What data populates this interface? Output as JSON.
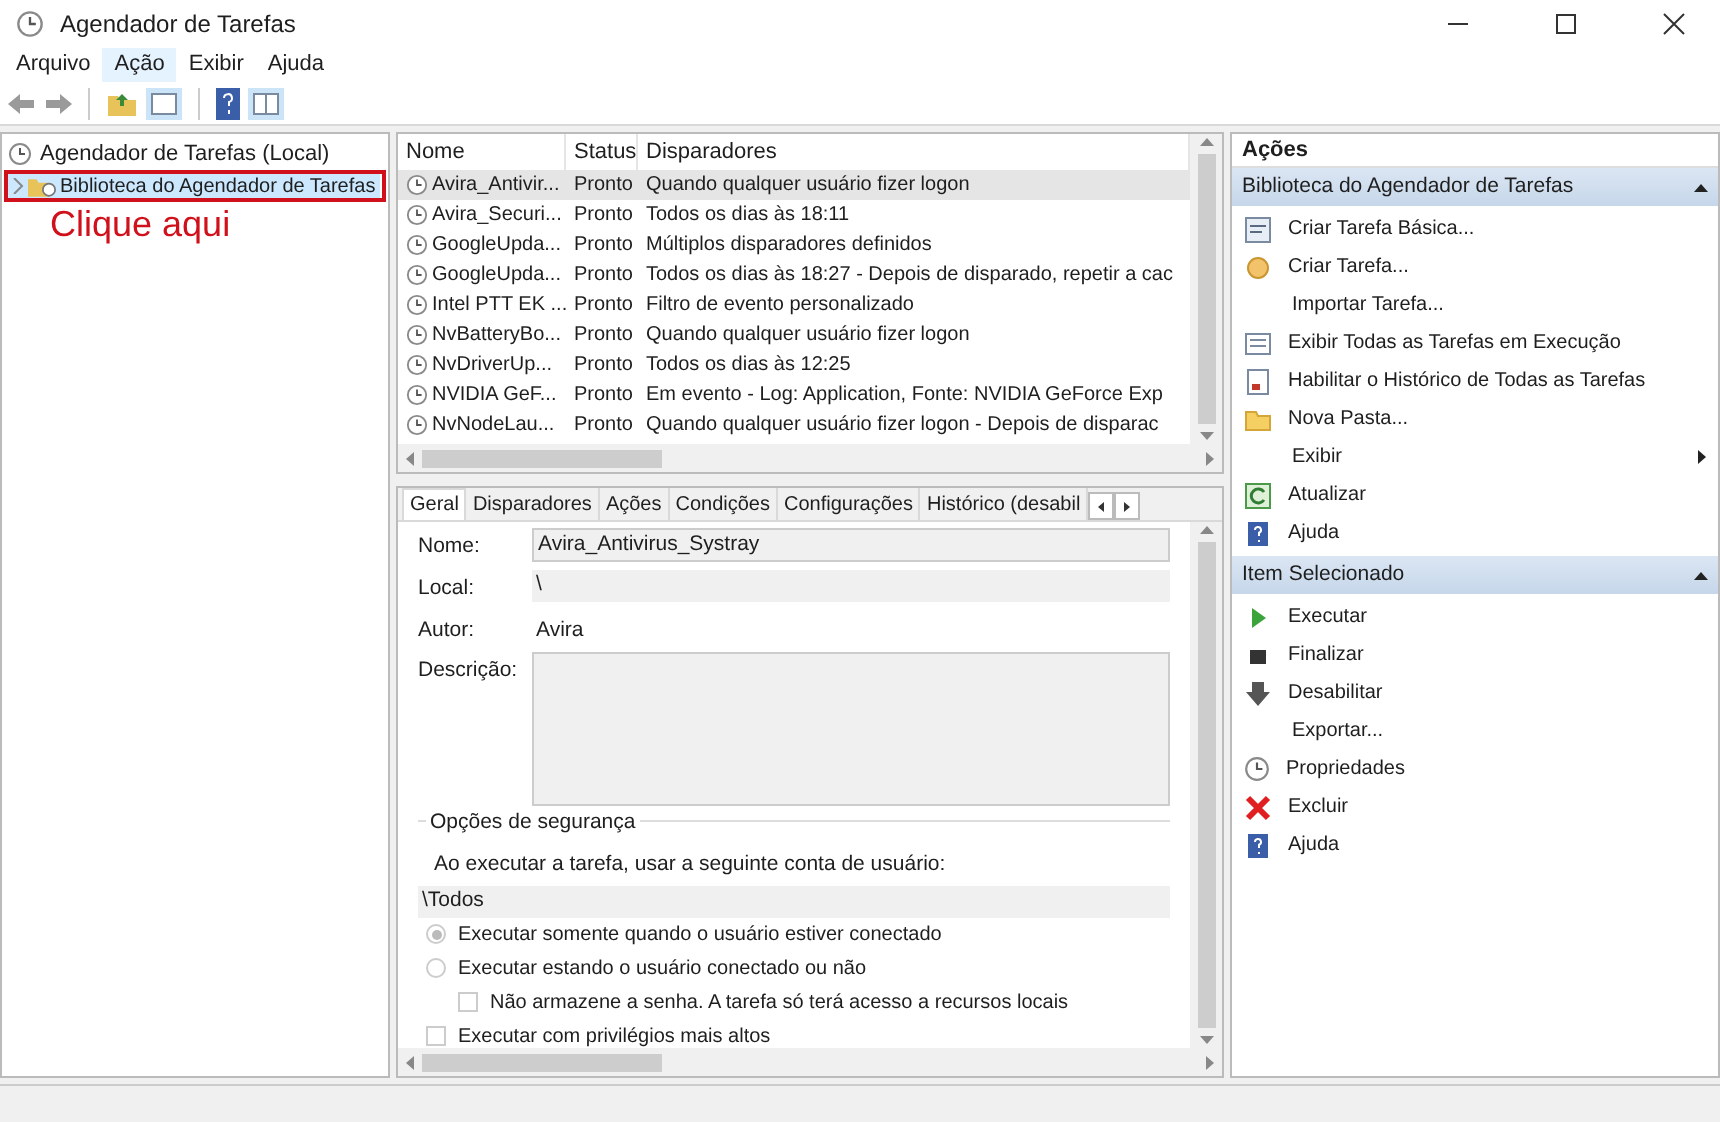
{
  "window": {
    "title": "Agendador de Tarefas"
  },
  "menu": [
    {
      "label": "Arquivo",
      "selected": false
    },
    {
      "label": "Ação",
      "selected": true
    },
    {
      "label": "Exibir",
      "selected": false
    },
    {
      "label": "Ajuda",
      "selected": false
    }
  ],
  "tree": {
    "label": "Agendador de Tarefas (Local)",
    "children": [
      {
        "label": "Biblioteca do Agendador de Tarefas",
        "selected": true,
        "expanded": false
      }
    ]
  },
  "annotation": {
    "text": "Clique aqui"
  },
  "task_table": {
    "columns": [
      "Nome",
      "Status",
      "Disparadores"
    ],
    "rows": [
      {
        "cells": [
          "Avira_Antivir...",
          "Pronto",
          "Quando qualquer usuário fizer logon"
        ],
        "selected": true
      },
      {
        "cells": [
          "Avira_Securi...",
          "Pronto",
          "Todos os dias às 18:11"
        ],
        "selected": false
      },
      {
        "cells": [
          "GoogleUpda...",
          "Pronto",
          "Múltiplos disparadores definidos"
        ],
        "selected": false
      },
      {
        "cells": [
          "GoogleUpda...",
          "Pronto",
          "Todos os dias às 18:27 - Depois de disparado, repetir a cac"
        ],
        "selected": false
      },
      {
        "cells": [
          "Intel PTT EK ...",
          "Pronto",
          "Filtro de evento personalizado"
        ],
        "selected": false
      },
      {
        "cells": [
          "NvBatteryBo...",
          "Pronto",
          "Quando qualquer usuário fizer logon"
        ],
        "selected": false
      },
      {
        "cells": [
          "NvDriverUp...",
          "Pronto",
          "Todos os dias às 12:25"
        ],
        "selected": false
      },
      {
        "cells": [
          "NVIDIA GeF...",
          "Pronto",
          "Em evento - Log: Application, Fonte: NVIDIA GeForce Exp"
        ],
        "selected": false
      },
      {
        "cells": [
          "NvNodeLau...",
          "Pronto",
          "Quando qualquer usuário fizer logon - Depois de disparac"
        ],
        "selected": false
      }
    ]
  },
  "detail_tabs": [
    {
      "label": "Geral",
      "selected": true
    },
    {
      "label": "Disparadores",
      "selected": false
    },
    {
      "label": "Ações",
      "selected": false
    },
    {
      "label": "Condições",
      "selected": false
    },
    {
      "label": "Configurações",
      "selected": false
    },
    {
      "label": "Histórico (desabil",
      "selected": false
    }
  ],
  "general": {
    "fields": [
      {
        "label": "Nome:",
        "value": "Avira_Antivirus_Systray",
        "kind": "input"
      },
      {
        "label": "Local:",
        "value": "\\",
        "kind": "readonly"
      },
      {
        "label": "Autor:",
        "value": "Avira",
        "kind": "text"
      },
      {
        "label": "Descrição:",
        "kind": "textarea"
      }
    ],
    "security": {
      "title": "Opções de segurança",
      "prompt": "Ao executar a tarefa, usar a seguinte conta de usuário:",
      "account": "\\Todos",
      "options": [
        {
          "label": "Executar somente quando o usuário estiver conectado",
          "kind": "radio",
          "selected": true
        },
        {
          "label": "Executar estando o usuário conectado ou não",
          "kind": "radio",
          "selected": false
        },
        {
          "label": "Não armazene a senha. A tarefa só terá acesso a recursos locais",
          "kind": "checkbox",
          "checked": false,
          "indented": true
        },
        {
          "label": "Executar com privilégios mais altos",
          "kind": "checkbox",
          "checked": false,
          "indented": false
        }
      ]
    }
  },
  "actions": {
    "title": "Ações",
    "sections": [
      {
        "title": "Biblioteca do Agendador de Tarefas",
        "expanded": true,
        "items": [
          {
            "label": "Criar Tarefa Básica..."
          },
          {
            "label": "Criar Tarefa..."
          },
          {
            "label": "Importar Tarefa..."
          },
          {
            "label": "Exibir Todas as Tarefas em Execução"
          },
          {
            "label": "Habilitar o Histórico de Todas as Tarefas"
          },
          {
            "label": "Nova Pasta..."
          },
          {
            "label": "Exibir",
            "submenu": true
          },
          {
            "label": "Atualizar"
          },
          {
            "label": "Ajuda"
          }
        ]
      },
      {
        "title": "Item Selecionado",
        "expanded": true,
        "items": [
          {
            "label": "Executar"
          },
          {
            "label": "Finalizar"
          },
          {
            "label": "Desabilitar"
          },
          {
            "label": "Exportar..."
          },
          {
            "label": "Propriedades"
          },
          {
            "label": "Excluir"
          },
          {
            "label": "Ajuda"
          }
        ]
      }
    ]
  }
}
